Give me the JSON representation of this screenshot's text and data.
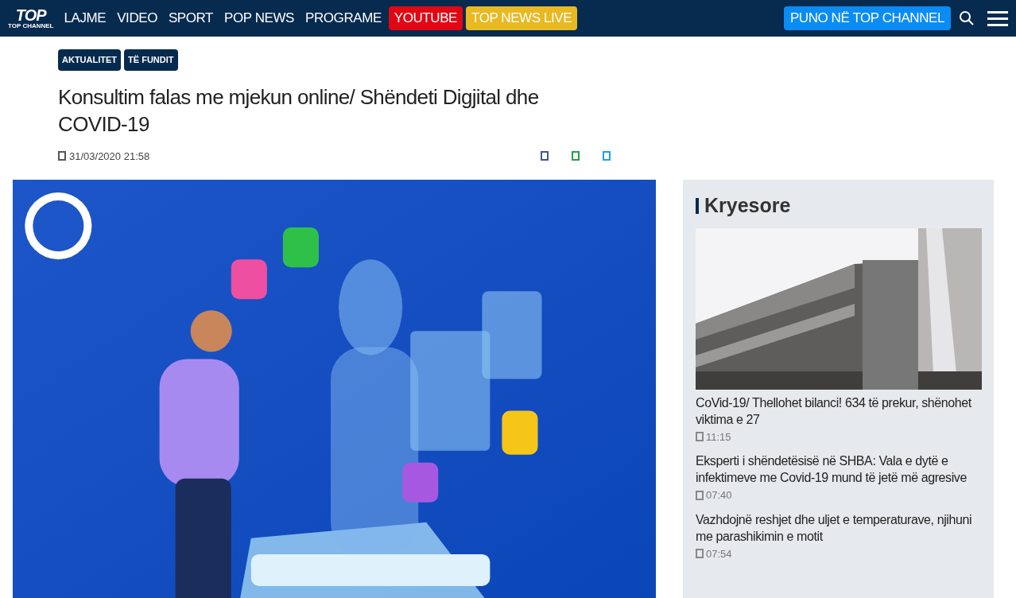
{
  "logo": {
    "text": "TOP",
    "subtitle": "TOP CHANNEL"
  },
  "nav": [
    {
      "label": "LAJME",
      "kind": "link"
    },
    {
      "label": "VIDEO",
      "kind": "link"
    },
    {
      "label": "SPORT",
      "kind": "link"
    },
    {
      "label": "POP NEWS",
      "kind": "link"
    },
    {
      "label": "PROGRAME",
      "kind": "link"
    },
    {
      "label": "YOUTUBE",
      "kind": "badge",
      "color": "#e20613"
    },
    {
      "label": "TOP NEWS LIVE",
      "kind": "badge",
      "color": "#e8b921"
    }
  ],
  "jobs_button": {
    "label": "PUNO NË TOP CHANNEL"
  },
  "article": {
    "tags": [
      "AKTUALITET",
      "TË FUNDIT"
    ],
    "title": "Konsultim falas me mjekun online/ Shëndeti Digjital dhe COVID-19",
    "date": "31/03/2020 21:58",
    "share": [
      {
        "color": "#3b5998"
      },
      {
        "color": "#25a244"
      },
      {
        "color": "#1da1f2"
      }
    ],
    "image": {
      "kind": "picture"
    }
  },
  "sidebar": {
    "title": "Kryesore",
    "image": {
      "kind": "picture"
    },
    "items": [
      {
        "title": "CoVid-19/ Thellohet bilanci! 634 të prekur, shënohet viktima e 27",
        "time": "11:15"
      },
      {
        "title": "Eksperti i shëndetësisë në SHBA: Vala e dytë e infektimeve me Covid-19 mund të jetë më agresive",
        "time": "07:40"
      },
      {
        "title": "Vazhdojnë reshjet dhe uljet e temperaturave, njihuni me parashikimin e motit",
        "time": "07:54"
      }
    ]
  }
}
